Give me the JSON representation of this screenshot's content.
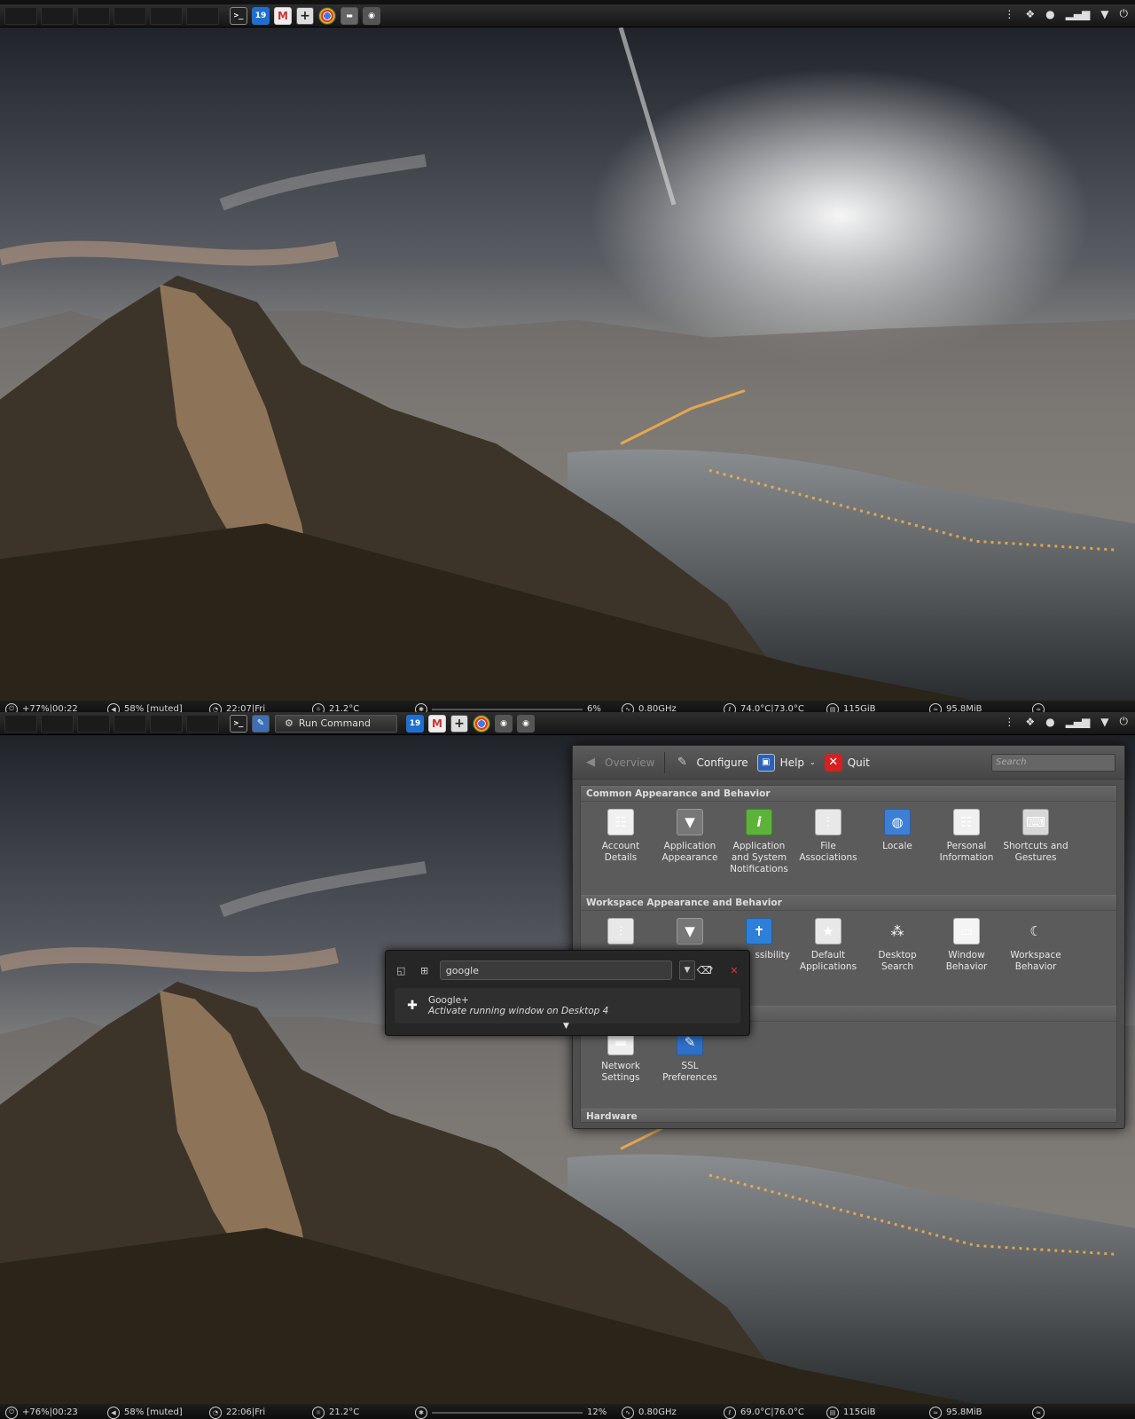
{
  "top_panel_1": {
    "launchers": [
      "terminal-icon",
      "calendar-icon",
      "gmail-icon",
      "add-icon",
      "chrome-icon",
      "pictures-icon",
      "webcam-icon"
    ],
    "calendar_day": "19",
    "tray": [
      "menu-dots-icon",
      "dropbox-icon",
      "chat-icon",
      "signal-icon",
      "dropdown-icon",
      "power-icon"
    ]
  },
  "bottom_panel_1": {
    "battery": "+77%|00:22",
    "volume": "58% [muted]",
    "clock": "22:07|Fri",
    "weather": "21.2°C",
    "cpu_load": "6%",
    "cpu_freq": "0.80GHz",
    "temps": "74.0°C|73.0°C",
    "disk": "115GiB",
    "wifi": "95.8MiB"
  },
  "top_panel_2": {
    "task_label": "Run Command",
    "calendar_day": "19"
  },
  "bottom_panel_2": {
    "battery": "+76%|00:23",
    "volume": "58% [muted]",
    "clock": "22:06|Fri",
    "weather": "21.2°C",
    "cpu_load": "12%",
    "cpu_freq": "0.80GHz",
    "temps": "69.0°C|76.0°C",
    "disk": "115GiB",
    "wifi": "95.8MiB"
  },
  "settings": {
    "toolbar": {
      "overview": "Overview",
      "configure": "Configure",
      "help": "Help",
      "quit": "Quit",
      "search_placeholder": "Search"
    },
    "groups": [
      {
        "title": "Common Appearance and Behavior",
        "items": [
          {
            "label": "Account Details",
            "icon": "account-details-icon"
          },
          {
            "label": "Application Appearance",
            "icon": "application-appearance-icon"
          },
          {
            "label": "Application and System Notifications",
            "icon": "notifications-icon"
          },
          {
            "label": "File Associations",
            "icon": "file-associations-icon"
          },
          {
            "label": "Locale",
            "icon": "locale-icon"
          },
          {
            "label": "Personal Information",
            "icon": "personal-information-icon"
          },
          {
            "label": "Shortcuts and Gestures",
            "icon": "shortcuts-icon"
          }
        ]
      },
      {
        "title": "Workspace Appearance and Behavior",
        "items": [
          {
            "label": "",
            "icon": "workspace-appearance-icon"
          },
          {
            "label": "",
            "icon": "desktop-effects-icon"
          },
          {
            "label": "ssibility",
            "icon": "accessibility-icon"
          },
          {
            "label": "Default Applications",
            "icon": "default-applications-icon"
          },
          {
            "label": "Desktop Search",
            "icon": "desktop-search-icon"
          },
          {
            "label": "Window Behavior",
            "icon": "window-behavior-icon"
          },
          {
            "label": "Workspace Behavior",
            "icon": "workspace-behavior-icon"
          }
        ]
      },
      {
        "title": "",
        "items": [
          {
            "label": "Network Settings",
            "icon": "network-settings-icon"
          },
          {
            "label": "SSL Preferences",
            "icon": "ssl-preferences-icon"
          }
        ]
      },
      {
        "title": "Hardware",
        "items": []
      }
    ]
  },
  "krunner": {
    "query": "google",
    "result_name": "Google+",
    "result_subtext": "Activate running window on Desktop 4"
  }
}
